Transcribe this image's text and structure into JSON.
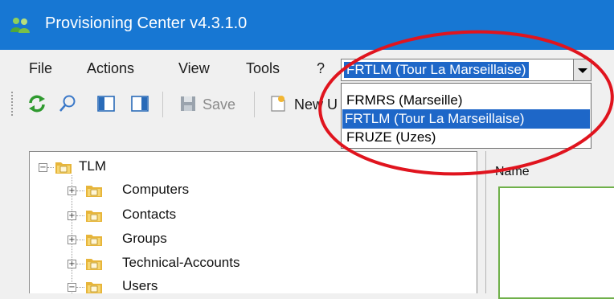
{
  "window": {
    "title": "Provisioning Center v4.3.1.0",
    "app_icon": "people-icon",
    "title_bar_color": "#1777d3"
  },
  "menu": {
    "items": [
      "File",
      "Actions",
      "View",
      "Tools",
      "?"
    ]
  },
  "site_selector": {
    "value": "FRTLM (Tour La Marseillaise)",
    "options": [
      "FRMRS (Marseille)",
      "FRTLM (Tour La Marseillaise)",
      "FRUZE (Uzes)"
    ],
    "selected_index": 1,
    "highlight_color": "#1e67c8"
  },
  "toolbar": {
    "icons": [
      "refresh-icon",
      "search-icon",
      "panel-left-icon",
      "panel-right-icon",
      "save-icon",
      "new-icon"
    ],
    "save_label": "Save",
    "new_label": "New U"
  },
  "tree": {
    "root": "TLM",
    "children": [
      "Computers",
      "Contacts",
      "Groups",
      "Technical-Accounts",
      "Users"
    ]
  },
  "right_panel": {
    "column_header": "Name"
  },
  "annotation": {
    "shape": "ellipse",
    "color": "#e0141e"
  }
}
